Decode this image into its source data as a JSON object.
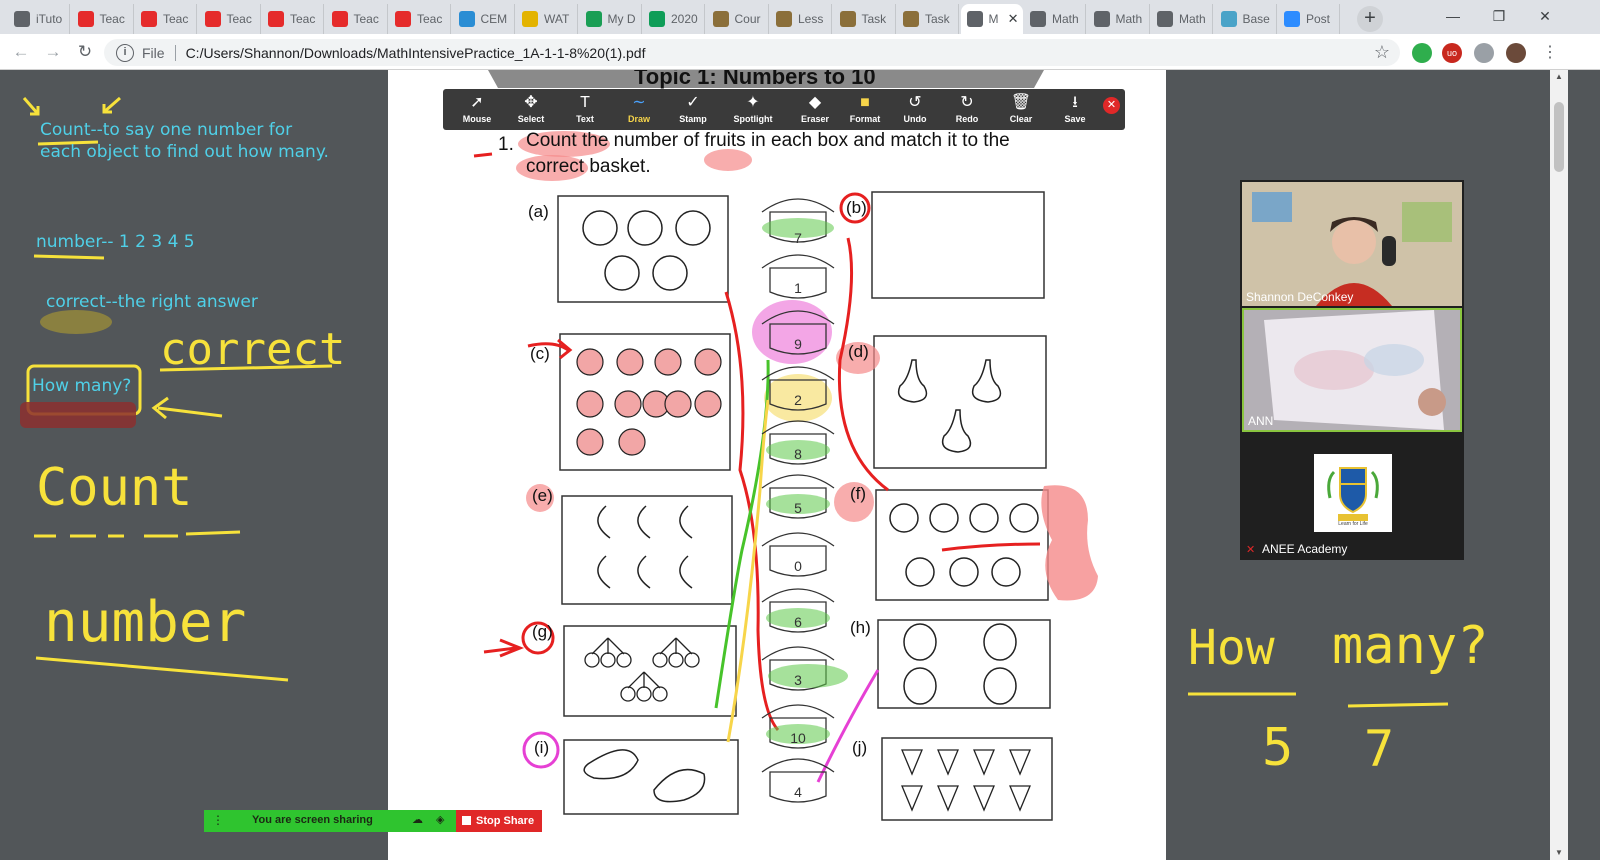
{
  "browser": {
    "tabs": [
      {
        "label": "iTuto",
        "icon": "globe-icon",
        "color": "#5f6368"
      },
      {
        "label": "Teac",
        "icon": "teach-icon",
        "color": "#e52b2b"
      },
      {
        "label": "Teac",
        "icon": "teach-icon",
        "color": "#e52b2b"
      },
      {
        "label": "Teac",
        "icon": "teach-icon",
        "color": "#e52b2b"
      },
      {
        "label": "Teac",
        "icon": "teach-icon",
        "color": "#e52b2b"
      },
      {
        "label": "Teac",
        "icon": "teach-icon",
        "color": "#e52b2b"
      },
      {
        "label": "Teac",
        "icon": "teach-icon",
        "color": "#e52b2b"
      },
      {
        "label": "CEM",
        "icon": "cem-icon",
        "color": "#2a8dd4"
      },
      {
        "label": "WAT",
        "icon": "wat-icon",
        "color": "#e3b300"
      },
      {
        "label": "My D",
        "icon": "drive-icon",
        "color": "#1a9e55"
      },
      {
        "label": "2020",
        "icon": "sheets-icon",
        "color": "#0f9d58"
      },
      {
        "label": "Cour",
        "icon": "course-icon",
        "color": "#8b6f3a"
      },
      {
        "label": "Less",
        "icon": "lesson-icon",
        "color": "#8b6f3a"
      },
      {
        "label": "Task",
        "icon": "task-icon",
        "color": "#8b6f3a"
      },
      {
        "label": "Task",
        "icon": "task-icon",
        "color": "#8b6f3a"
      },
      {
        "label": "M",
        "icon": "globe-icon",
        "color": "#5f6368",
        "active": true
      },
      {
        "label": "Math",
        "icon": "globe-icon",
        "color": "#5f6368"
      },
      {
        "label": "Math",
        "icon": "globe-icon",
        "color": "#5f6368"
      },
      {
        "label": "Math",
        "icon": "globe-icon",
        "color": "#5f6368"
      },
      {
        "label": "Base",
        "icon": "base-icon",
        "color": "#4aa3c8"
      },
      {
        "label": "Post",
        "icon": "zoom-icon",
        "color": "#2d8cff"
      }
    ],
    "address_scheme": "File",
    "address_url": "C:/Users/Shannon/Downloads/MathIntensivePractice_1A-1-1-8%20(1).pdf",
    "window_controls": [
      "—",
      "❐",
      "✕"
    ]
  },
  "left_notes": {
    "line1": "Count--to say one number for",
    "line2": "each object to find out how many.",
    "number_note": "number--  1 2 3 4 5",
    "correct_note": "correct--the right answer",
    "how_many_box": "How many?",
    "hw_correct": "correct",
    "hw_count": "Count",
    "hw_number": "number"
  },
  "right_notes": {
    "hw_how": "How",
    "hw_many": "many?",
    "hw_five": "5",
    "hw_seven": "7"
  },
  "annotation_toolbar": {
    "tools": [
      {
        "label": "Mouse",
        "glyph": "➚"
      },
      {
        "label": "Select",
        "glyph": "✥"
      },
      {
        "label": "Text",
        "glyph": "T"
      },
      {
        "label": "Draw",
        "glyph": "∼",
        "active": true
      },
      {
        "label": "Stamp",
        "glyph": "✓"
      },
      {
        "label": "Spotlight",
        "glyph": "✦"
      },
      {
        "label": "Eraser",
        "glyph": "◆"
      },
      {
        "label": "Format",
        "glyph": "■"
      },
      {
        "label": "Undo",
        "glyph": "↺"
      },
      {
        "label": "Redo",
        "glyph": "↻"
      },
      {
        "label": "Clear",
        "glyph": "🗑"
      },
      {
        "label": "Save",
        "glyph": "⭳"
      }
    ],
    "close_glyph": "✕"
  },
  "worksheet": {
    "topic": "Topic 1: Numbers to 10",
    "q_num": "1.",
    "q_line1": "Count the number of fruits in each box and match it to the",
    "q_line2": "correct basket.",
    "labels": [
      "(a)",
      "(b)",
      "(c)",
      "(d)",
      "(e)",
      "(f)",
      "(g)",
      "(h)",
      "(i)",
      "(j)"
    ],
    "baskets": [
      "7",
      "1",
      "9",
      "2",
      "8",
      "5",
      "0",
      "6",
      "3",
      "10",
      "4"
    ]
  },
  "video": {
    "p1": "Shannon DeConkey",
    "p2": "ANN",
    "p3": "ANEE Academy",
    "logo_tagline": "Learn for Life"
  },
  "share": {
    "status": "You are screen sharing",
    "stop": "Stop Share"
  }
}
